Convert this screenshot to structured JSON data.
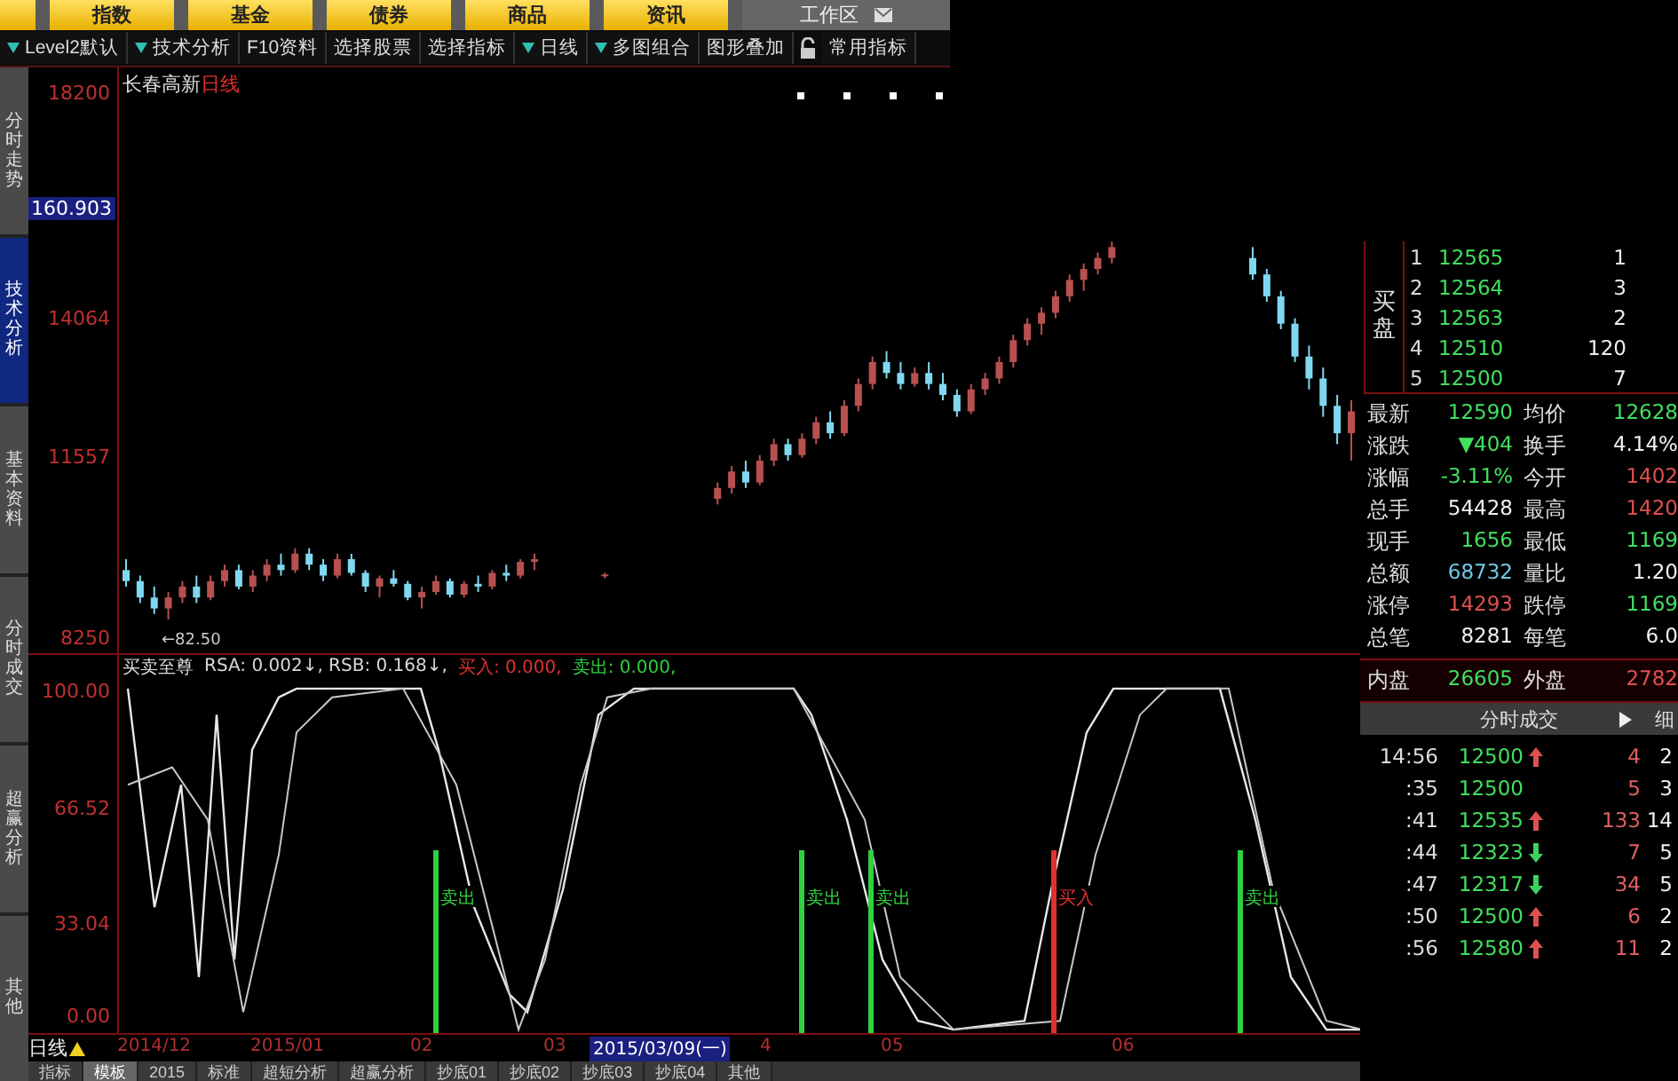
{
  "top_tabs": [
    {
      "label": "指数"
    },
    {
      "label": "基金"
    },
    {
      "label": "债券"
    },
    {
      "label": "商品"
    },
    {
      "label": "资讯"
    }
  ],
  "workspace": {
    "label": "工作区"
  },
  "toolbar": [
    {
      "kind": "menu",
      "label": "Level2默认",
      "dropdown": true
    },
    {
      "kind": "menu",
      "label": "技术分析",
      "dropdown": true
    },
    {
      "kind": "menu",
      "label": "F10资料",
      "dropdown": false
    },
    {
      "kind": "menu",
      "label": "选择股票",
      "dropdown": false
    },
    {
      "kind": "menu",
      "label": "选择指标",
      "dropdown": false
    },
    {
      "kind": "menu",
      "label": "日线",
      "dropdown": true
    },
    {
      "kind": "menu",
      "label": "多图组合",
      "dropdown": true
    },
    {
      "kind": "menu",
      "label": "图形叠加",
      "dropdown": false
    },
    {
      "kind": "lock"
    },
    {
      "kind": "menu",
      "label": "常用指标",
      "dropdown": false
    }
  ],
  "side_tabs": [
    {
      "label": "分时走势",
      "selected": false
    },
    {
      "label": "技术分析",
      "selected": true
    },
    {
      "label": "基本资料",
      "selected": false
    },
    {
      "label": "分时成交",
      "selected": false
    },
    {
      "label": "超赢分析",
      "selected": false
    },
    {
      "label": "其他",
      "selected": false
    }
  ],
  "price_axis": {
    "current": "160.903"
  },
  "chart": {
    "title": "长春高新",
    "period": "日线",
    "low_marker": "←82.50",
    "chart_data": {
      "type": "candlestick",
      "ylim": [
        7950,
        18680
      ],
      "yticks": [
        18200,
        14064,
        11557,
        8250
      ],
      "ohlc": [
        [
          9500,
          9700,
          9200,
          9300
        ],
        [
          9300,
          9400,
          8900,
          9000
        ],
        [
          9000,
          9200,
          8700,
          8800
        ],
        [
          8800,
          9100,
          8600,
          9000
        ],
        [
          9000,
          9300,
          8900,
          9200
        ],
        [
          9200,
          9400,
          8900,
          9000
        ],
        [
          9000,
          9400,
          8950,
          9300
        ],
        [
          9300,
          9600,
          9200,
          9500
        ],
        [
          9500,
          9600,
          9150,
          9200
        ],
        [
          9200,
          9500,
          9100,
          9400
        ],
        [
          9400,
          9700,
          9300,
          9600
        ],
        [
          9600,
          9800,
          9400,
          9500
        ],
        [
          9500,
          9900,
          9450,
          9800
        ],
        [
          9800,
          9900,
          9500,
          9600
        ],
        [
          9600,
          9700,
          9300,
          9400
        ],
        [
          9400,
          9800,
          9350,
          9700
        ],
        [
          9700,
          9800,
          9400,
          9450
        ],
        [
          9450,
          9500,
          9100,
          9200
        ],
        [
          9200,
          9400,
          9000,
          9350
        ],
        [
          9350,
          9500,
          9200,
          9250
        ],
        [
          9250,
          9300,
          8950,
          9000
        ],
        [
          9000,
          9200,
          8800,
          9100
        ],
        [
          9100,
          9400,
          9050,
          9300
        ],
        [
          9300,
          9350,
          9000,
          9050
        ],
        [
          9050,
          9300,
          9000,
          9250
        ],
        [
          9250,
          9400,
          9100,
          9200
        ],
        [
          9200,
          9500,
          9150,
          9450
        ],
        [
          9450,
          9600,
          9300,
          9400
        ],
        [
          9400,
          9700,
          9350,
          9650
        ],
        [
          9650,
          9800,
          9500,
          9700
        ],
        null,
        null,
        null,
        null,
        [
          9400,
          9450,
          9350,
          9420
        ],
        null,
        null,
        null,
        null,
        null,
        null,
        null,
        [
          10800,
          11100,
          10700,
          11000
        ],
        [
          11000,
          11400,
          10900,
          11300
        ],
        [
          11300,
          11500,
          11000,
          11100
        ],
        [
          11100,
          11600,
          11050,
          11500
        ],
        [
          11500,
          11900,
          11400,
          11800
        ],
        [
          11800,
          11900,
          11500,
          11600
        ],
        [
          11600,
          12000,
          11550,
          11900
        ],
        [
          11900,
          12300,
          11800,
          12200
        ],
        [
          12200,
          12400,
          11900,
          12000
        ],
        [
          12000,
          12600,
          11950,
          12500
        ],
        [
          12500,
          13000,
          12400,
          12900
        ],
        [
          12900,
          13400,
          12800,
          13300
        ],
        [
          13300,
          13500,
          13000,
          13100
        ],
        [
          13100,
          13300,
          12800,
          12900
        ],
        [
          12900,
          13200,
          12850,
          13100
        ],
        [
          13100,
          13300,
          12800,
          12900
        ],
        [
          12900,
          13100,
          12600,
          12700
        ],
        [
          12700,
          12800,
          12300,
          12400
        ],
        [
          12400,
          12900,
          12350,
          12800
        ],
        [
          12800,
          13100,
          12700,
          13000
        ],
        [
          13000,
          13400,
          12900,
          13300
        ],
        [
          13300,
          13800,
          13200,
          13700
        ],
        [
          13700,
          14100,
          13600,
          14000
        ],
        [
          14000,
          14300,
          13800,
          14200
        ],
        [
          14200,
          14600,
          14100,
          14500
        ],
        [
          14500,
          14900,
          14400,
          14800
        ],
        [
          14800,
          15100,
          14600,
          15000
        ],
        [
          15000,
          15300,
          14900,
          15200
        ],
        [
          15200,
          15500,
          15100,
          15400
        ],
        null,
        null,
        null,
        null,
        null,
        null,
        null,
        null,
        null,
        [
          15200,
          15400,
          14800,
          14900
        ],
        [
          14900,
          15000,
          14400,
          14500
        ],
        [
          14500,
          14600,
          13900,
          14000
        ],
        [
          14000,
          14100,
          13300,
          13400
        ],
        [
          13400,
          13600,
          12800,
          13000
        ],
        [
          13000,
          13200,
          12300,
          12500
        ],
        [
          12500,
          12700,
          11800,
          12000
        ],
        [
          12000,
          12600,
          11500,
          12400
        ]
      ]
    }
  },
  "indicator": {
    "name": "买卖至尊",
    "legend": [
      {
        "kind": "value",
        "text": "RSA: 0.002↓, RSB: 0.168↓,"
      },
      {
        "kind": "buy",
        "text": "买入: 0.000,"
      },
      {
        "kind": "sell",
        "text": "卖出: 0.000,"
      }
    ],
    "ticks": [
      "100.00",
      "66.52",
      "33.04",
      "0.00"
    ],
    "signals": [
      {
        "kind": "sell",
        "label": "卖出"
      },
      {
        "kind": "sell",
        "label": "卖出"
      },
      {
        "kind": "sell",
        "label": "卖出"
      },
      {
        "kind": "buy",
        "label": "买入"
      },
      {
        "kind": "sell",
        "label": "卖出"
      }
    ]
  },
  "date_axis": {
    "period": "日线",
    "labels": [
      {
        "text": "2014/12",
        "selected": false
      },
      {
        "text": "2015/01",
        "selected": false
      },
      {
        "text": "02",
        "selected": false
      },
      {
        "text": "03",
        "selected": false
      },
      {
        "text": "2015/03/09(一)",
        "selected": true
      },
      {
        "text": "4",
        "selected": false
      },
      {
        "text": "05",
        "selected": false
      },
      {
        "text": "06",
        "selected": false
      }
    ]
  },
  "bottom_tabs": [
    {
      "label": "指标",
      "selected": false
    },
    {
      "label": "模板",
      "selected": true
    },
    {
      "label": "2015",
      "selected": false
    },
    {
      "label": "标准",
      "selected": false
    },
    {
      "label": "超短分析",
      "selected": false
    },
    {
      "label": "超赢分析",
      "selected": false
    },
    {
      "label": "抄底01",
      "selected": false
    },
    {
      "label": "抄底02",
      "selected": false
    },
    {
      "label": "抄底03",
      "selected": false
    },
    {
      "label": "抄底04",
      "selected": false
    },
    {
      "label": "其他",
      "selected": false
    }
  ],
  "order_book": {
    "side": "买盘",
    "levels": [
      {
        "n": "1",
        "price": "12565",
        "volume": "1"
      },
      {
        "n": "2",
        "price": "12564",
        "volume": "3"
      },
      {
        "n": "3",
        "price": "12563",
        "volume": "2"
      },
      {
        "n": "4",
        "price": "12510",
        "volume": "120"
      },
      {
        "n": "5",
        "price": "12500",
        "volume": "7"
      }
    ]
  },
  "stats": [
    {
      "label": "最新",
      "value": "12590",
      "color": "#40e060"
    },
    {
      "label": "均价",
      "value": "12628",
      "color": "#40e060"
    },
    {
      "label": "涨跌",
      "value": "▼404",
      "color": "#40e060"
    },
    {
      "label": "换手",
      "value": "4.14%",
      "color": "#f0f0f0"
    },
    {
      "label": "涨幅",
      "value": "-3.11%",
      "color": "#40e060"
    },
    {
      "label": "今开",
      "value": "1402",
      "color": "#e05050"
    },
    {
      "label": "总手",
      "value": "54428",
      "color": "#f0f0f0"
    },
    {
      "label": "最高",
      "value": "1420",
      "color": "#e05050"
    },
    {
      "label": "现手",
      "value": "1656",
      "color": "#40e060"
    },
    {
      "label": "最低",
      "value": "1169",
      "color": "#40e060"
    },
    {
      "label": "总额",
      "value": "68732",
      "color": "#70c8e8"
    },
    {
      "label": "量比",
      "value": "1.20",
      "color": "#f0f0f0"
    },
    {
      "label": "涨停",
      "value": "14293",
      "color": "#e05050"
    },
    {
      "label": "跌停",
      "value": "1169",
      "color": "#40e060"
    },
    {
      "label": "总笔",
      "value": "8281",
      "color": "#f0f0f0"
    },
    {
      "label": "每笔",
      "value": "6.0",
      "color": "#f0f0f0"
    }
  ],
  "inner_outer": [
    {
      "label": "内盘",
      "value": "26605",
      "color": "#40e060"
    },
    {
      "label": "外盘",
      "value": "2782",
      "color": "#e05050"
    }
  ],
  "trades_header": {
    "title": "分时成交",
    "detail": "细"
  },
  "trades": [
    {
      "time": "14:56",
      "price": "12500",
      "kind": "up",
      "volume": "4",
      "count": "2"
    },
    {
      "time": ":35",
      "price": "12500",
      "kind": "flat",
      "volume": "5",
      "count": "3"
    },
    {
      "time": ":41",
      "price": "12535",
      "kind": "up",
      "volume": "133",
      "count": "14"
    },
    {
      "time": ":44",
      "price": "12323",
      "kind": "down",
      "volume": "7",
      "count": "5"
    },
    {
      "time": ":47",
      "price": "12317",
      "kind": "down",
      "volume": "34",
      "count": "5"
    },
    {
      "time": ":50",
      "price": "12500",
      "kind": "up",
      "volume": "6",
      "count": "2"
    },
    {
      "time": ":56",
      "price": "12580",
      "kind": "up",
      "volume": "11",
      "count": "2"
    }
  ]
}
